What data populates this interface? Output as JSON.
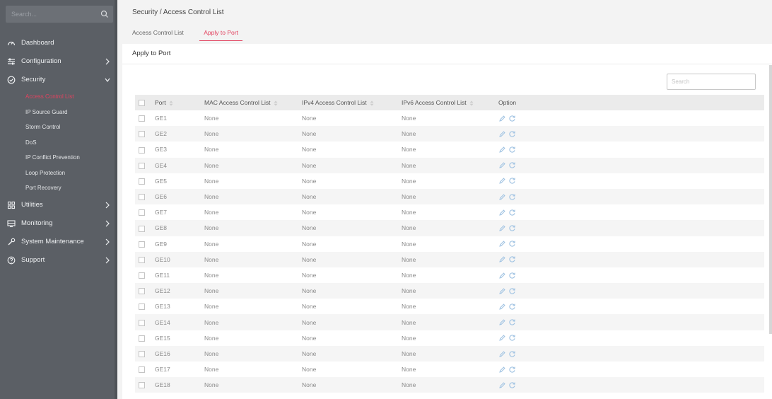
{
  "sidebar": {
    "search_placeholder": "Search...",
    "items": [
      {
        "label": "Dashboard",
        "icon": "dashboard-icon",
        "chevron": false
      },
      {
        "label": "Configuration",
        "icon": "sliders-icon",
        "chevron": true
      },
      {
        "label": "Security",
        "icon": "shield-icon",
        "chevron": true,
        "expanded": true
      }
    ],
    "security_subitems": [
      {
        "label": "Access Control List",
        "active": true
      },
      {
        "label": "IP Source Guard"
      },
      {
        "label": "Storm Control"
      },
      {
        "label": "DoS"
      },
      {
        "label": "IP Conflict Prevention"
      },
      {
        "label": "Loop Protection"
      },
      {
        "label": "Port Recovery"
      }
    ],
    "items_after": [
      {
        "label": "Utilities",
        "icon": "grid-icon"
      },
      {
        "label": "Monitoring",
        "icon": "monitor-icon"
      },
      {
        "label": "System Maintenance",
        "icon": "wrench-icon"
      },
      {
        "label": "Support",
        "icon": "help-icon"
      }
    ]
  },
  "breadcrumb": "Security / Access Control List",
  "tabs": [
    "Access Control List",
    "Apply to Port"
  ],
  "active_tab": "Apply to Port",
  "panel": {
    "title": "Apply to Port",
    "search_placeholder": "Search"
  },
  "table": {
    "headers": [
      "Port",
      "MAC Access Control List",
      "IPv4 Access Control List",
      "IPv6 Access Control List",
      "Option"
    ],
    "rows": [
      [
        "GE1",
        "None",
        "None",
        "None"
      ],
      [
        "GE2",
        "None",
        "None",
        "None"
      ],
      [
        "GE3",
        "None",
        "None",
        "None"
      ],
      [
        "GE4",
        "None",
        "None",
        "None"
      ],
      [
        "GE5",
        "None",
        "None",
        "None"
      ],
      [
        "GE6",
        "None",
        "None",
        "None"
      ],
      [
        "GE7",
        "None",
        "None",
        "None"
      ],
      [
        "GE8",
        "None",
        "None",
        "None"
      ],
      [
        "GE9",
        "None",
        "None",
        "None"
      ],
      [
        "GE10",
        "None",
        "None",
        "None"
      ],
      [
        "GE11",
        "None",
        "None",
        "None"
      ],
      [
        "GE12",
        "None",
        "None",
        "None"
      ],
      [
        "GE13",
        "None",
        "None",
        "None"
      ],
      [
        "GE14",
        "None",
        "None",
        "None"
      ],
      [
        "GE15",
        "None",
        "None",
        "None"
      ],
      [
        "GE16",
        "None",
        "None",
        "None"
      ],
      [
        "GE17",
        "None",
        "None",
        "None"
      ],
      [
        "GE18",
        "None",
        "None",
        "None"
      ]
    ],
    "option_icons": [
      "edit-icon",
      "reset-icon"
    ]
  },
  "colors": {
    "sidebar_bg": "#5b5f65",
    "accent": "#e2435f",
    "action_icon": "#9fc2e2",
    "header_bg": "#ebebeb",
    "alt_row": "#f5f5f5"
  }
}
